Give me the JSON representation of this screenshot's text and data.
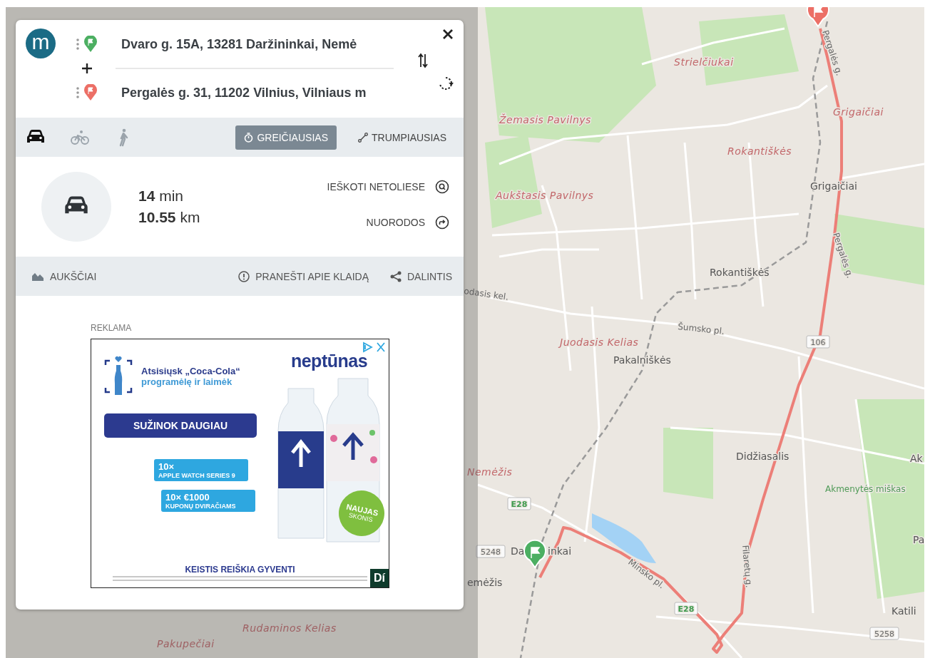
{
  "map": {
    "labels": [
      {
        "kind": "district",
        "text": "Strielčiukai"
      },
      {
        "kind": "district",
        "text": "Žemasis Pavilnys"
      },
      {
        "kind": "district",
        "text": "Grigaičiai"
      },
      {
        "kind": "district",
        "text": "Rokantiškės"
      },
      {
        "kind": "district",
        "text": "Aukštasis Pavilnys"
      },
      {
        "kind": "place",
        "text": "Grigaičiai"
      },
      {
        "kind": "place",
        "text": "Rokantiškės"
      },
      {
        "kind": "street",
        "text": "Pergalės g."
      },
      {
        "kind": "street",
        "text": "Pergalės g."
      },
      {
        "kind": "street",
        "text": "odasis kel."
      },
      {
        "kind": "street",
        "text": "Šumsko pl."
      },
      {
        "kind": "district",
        "text": "Juodasis Kelias"
      },
      {
        "kind": "place",
        "text": "Pakalniškės"
      },
      {
        "kind": "road_number",
        "text": "106"
      },
      {
        "kind": "place",
        "text": "Didžiasalis"
      },
      {
        "kind": "place",
        "text": "Ak"
      },
      {
        "kind": "forest",
        "text": "Akmenytės miškas"
      },
      {
        "kind": "district",
        "text": "Nemėžis"
      },
      {
        "kind": "road_number",
        "text": "E28"
      },
      {
        "kind": "place",
        "text": "Pa"
      },
      {
        "kind": "road_number",
        "text": "5248"
      },
      {
        "kind": "place",
        "text": "Da"
      },
      {
        "kind": "place",
        "text": "inkai"
      },
      {
        "kind": "place",
        "text": "emėžis"
      },
      {
        "kind": "street",
        "text": "Minsko pl."
      },
      {
        "kind": "street",
        "text": "Filaretų g."
      },
      {
        "kind": "road_number",
        "text": "E28"
      },
      {
        "kind": "place",
        "text": "Katili"
      },
      {
        "kind": "road_number",
        "text": "5258"
      },
      {
        "kind": "district",
        "text": "Rudaminos Kelias"
      },
      {
        "kind": "district",
        "text": "Pakupečiai"
      }
    ]
  },
  "panel": {
    "logo": "m",
    "route": {
      "origin": {
        "value": "Dvaro g. 15A, 13281 Daržininkai, Nemė"
      },
      "destination": {
        "value": "Pergalės g. 31, 11202 Vilnius, Vilniaus m"
      }
    },
    "modes": [
      {
        "kind": "car",
        "selected": true
      },
      {
        "kind": "bike",
        "selected": false
      },
      {
        "kind": "walk",
        "selected": false
      }
    ],
    "route_options": [
      {
        "kind": "fastest",
        "label": "GREIČIAUSIAS",
        "selected": true
      },
      {
        "kind": "shortest",
        "label": "TRUMPIAUSIAS",
        "selected": false
      }
    ],
    "summary": {
      "duration_value": "14",
      "duration_unit": "min",
      "distance_value": "10.55",
      "distance_unit": "km"
    },
    "summary_links": [
      {
        "kind": "nearby",
        "label": "IEŠKOTI NETOLIESE"
      },
      {
        "kind": "directions",
        "label": "NUORODOS"
      }
    ],
    "actions": [
      {
        "kind": "elevation",
        "label": "AUKŠČIAI"
      },
      {
        "kind": "report",
        "label": "PRANEŠTI APIE KLAIDĄ"
      },
      {
        "kind": "share",
        "label": "DALINTIS"
      }
    ],
    "ad": {
      "label": "REKLAMA",
      "headline": "Atsisiųsk „Coca-Cola“",
      "subline": "programėlę ir laimėk",
      "button": "SUŽINOK DAUGIAU",
      "prizes": [
        {
          "count": "10×",
          "title": "APPLE WATCH SERIES 9"
        },
        {
          "count": "10× €1000",
          "title": "KUPONŲ DVIRAČIAMS"
        }
      ],
      "brand": "neptūnas",
      "badge": "NAUJAS",
      "badge_sub": "SKONIS",
      "slogan": "KEISTIS REIŠKIA GYVENTI",
      "corner_logo": "Dí"
    }
  }
}
